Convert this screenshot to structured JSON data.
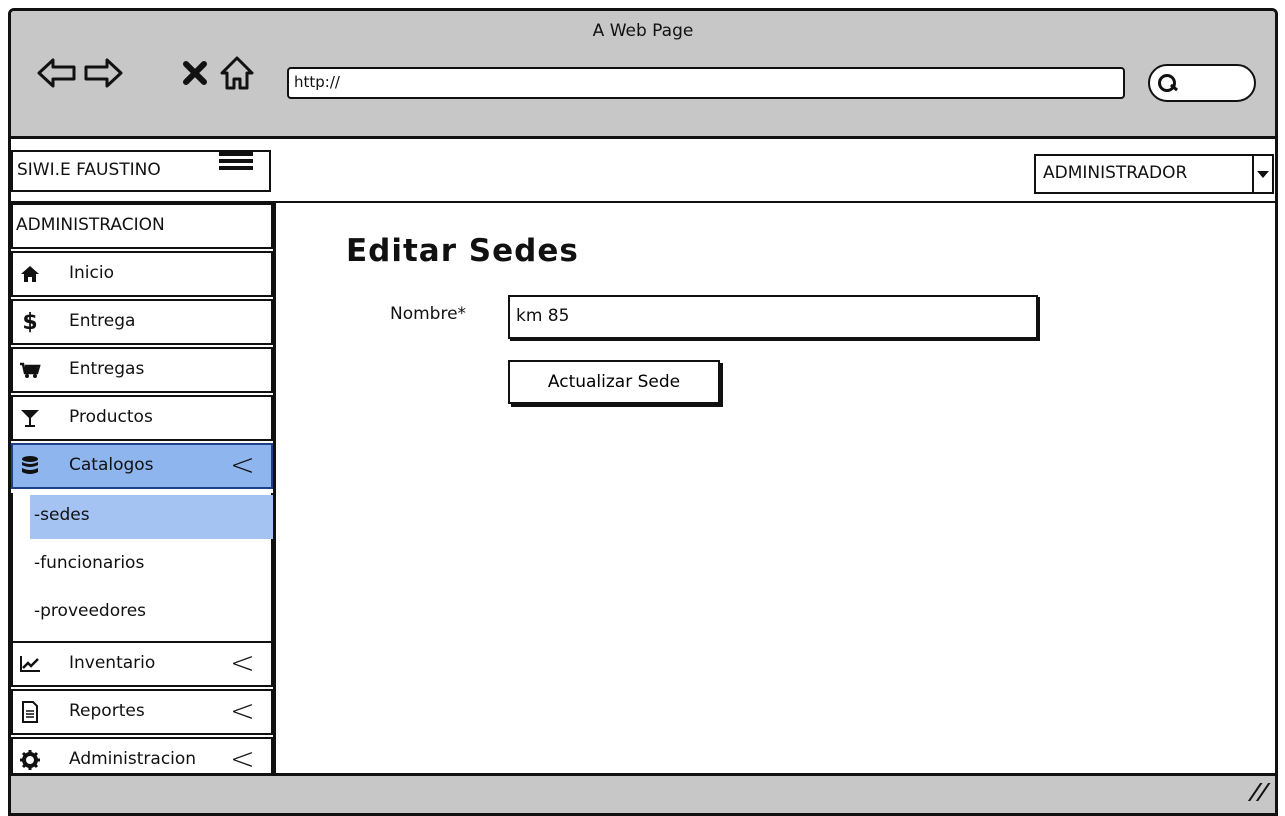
{
  "browser": {
    "title": "A Web Page",
    "url": "http://",
    "nav": [
      "back-icon",
      "forward-icon",
      "close-icon",
      "home-icon"
    ]
  },
  "app": {
    "brand": "SIWI.E FAUSTINO",
    "user_menu": "ADMINISTRADOR"
  },
  "sidebar": {
    "header": "ADMINISTRACION",
    "items": [
      {
        "label": "Inicio",
        "icon": "home-icon"
      },
      {
        "label": "Entrega",
        "icon": "dollar-icon"
      },
      {
        "label": "Entregas",
        "icon": "cart-icon"
      },
      {
        "label": "Productos",
        "icon": "glass-icon"
      },
      {
        "label": "Catalogos",
        "icon": "database-icon",
        "active": true
      },
      {
        "label": "Inventario",
        "icon": "chart-icon"
      },
      {
        "label": "Reportes",
        "icon": "document-icon"
      },
      {
        "label": "Administracion",
        "icon": "gear-icon"
      }
    ],
    "submenu": [
      "-sedes",
      "-funcionarios",
      "-proveedores"
    ]
  },
  "main": {
    "title": "Editar Sedes",
    "form": {
      "nombre_label": "Nombre*",
      "nombre_value": "km 85",
      "submit_label": "Actualizar Sede"
    }
  },
  "colors": {
    "active_item": "#8fb5ee",
    "active_sub": "#a4c2f2",
    "chrome": "#c7c7c7"
  }
}
